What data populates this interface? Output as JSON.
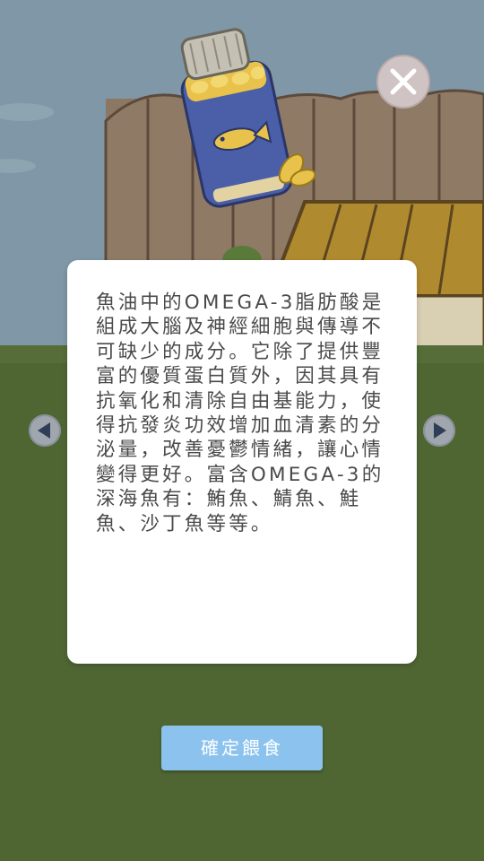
{
  "item": {
    "name_icon": "fish-oil-bottle-icon",
    "description": "魚油中的OMEGA-3脂肪酸是組成大腦及神經細胞與傳導不可缺少的成分。它除了提供豐富的優質蛋白質外，因其具有抗氧化和清除自由基能力，使得抗發炎功效增加血清素的分泌量，改善憂鬱情緒，讓心情變得更好。富含OMEGA-3的深海魚有：鮪魚、鯖魚、鮭魚、沙丁魚等等。"
  },
  "buttons": {
    "confirm_label": "確定餵食",
    "close_icon": "close-icon",
    "prev_icon": "arrow-left-icon",
    "next_icon": "arrow-right-icon"
  },
  "colors": {
    "sky": "#7f97a6",
    "grass": "#4f6532",
    "fence": "#8c7763",
    "confirm": "#8cc3ee",
    "card": "#ffffff"
  }
}
